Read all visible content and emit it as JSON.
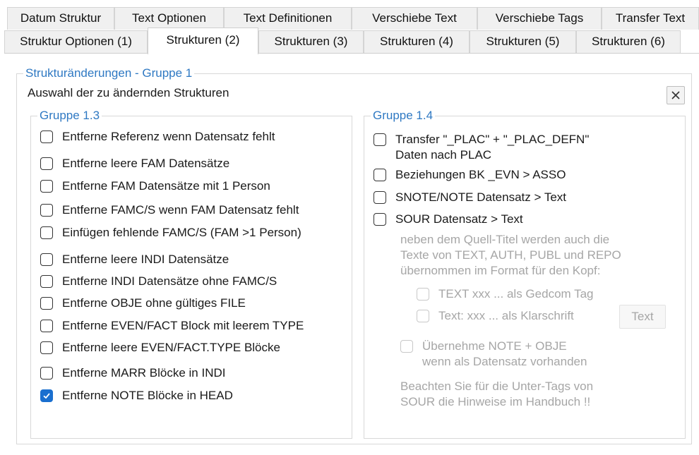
{
  "tabs_row1": [
    {
      "label": "Datum Struktur"
    },
    {
      "label": "Text Optionen"
    },
    {
      "label": "Text Definitionen"
    },
    {
      "label": "Verschiebe Text"
    },
    {
      "label": "Verschiebe Tags"
    },
    {
      "label": "Transfer Text"
    }
  ],
  "tabs_row2": [
    {
      "label": "Struktur Optionen (1)"
    },
    {
      "label": "Strukturen (2)",
      "active": true
    },
    {
      "label": "Strukturen (3)"
    },
    {
      "label": "Strukturen (4)"
    },
    {
      "label": "Strukturen (5)"
    },
    {
      "label": "Strukturen (6)"
    }
  ],
  "main": {
    "group_title": "Strukturänderungen - Gruppe 1",
    "subtitle": "Auswahl der zu ändernden Strukturen",
    "close_icon": "close-icon"
  },
  "group13": {
    "title": "Gruppe 1.3",
    "items": [
      {
        "label": "Entferne Referenz wenn Datensatz fehlt",
        "checked": false
      },
      {
        "label": "Entferne leere FAM Datensätze",
        "checked": false
      },
      {
        "label": "Entferne FAM Datensätze mit 1 Person",
        "checked": false
      },
      {
        "label": "Entferne FAMC/S wenn FAM Datensatz fehlt",
        "checked": false
      },
      {
        "label": "Einfügen fehlende FAMC/S (FAM >1 Person)",
        "checked": false
      },
      {
        "label": "Entferne leere INDI Datensätze",
        "checked": false
      },
      {
        "label": "Entferne INDI Datensätze ohne FAMC/S",
        "checked": false
      },
      {
        "label": "Entferne OBJE ohne gültiges FILE",
        "checked": false
      },
      {
        "label": "Entferne EVEN/FACT Block mit leerem TYPE",
        "checked": false
      },
      {
        "label": "Entferne leere EVEN/FACT.TYPE Blöcke",
        "checked": false
      },
      {
        "label": "Entferne MARR Blöcke in INDI",
        "checked": false
      },
      {
        "label": "Entferne NOTE Blöcke in HEAD",
        "checked": true
      }
    ]
  },
  "group14": {
    "title": "Gruppe 1.4",
    "items": [
      {
        "line1": "Transfer \"_PLAC\" + \"_PLAC_DEFN\"",
        "line2": "Daten nach PLAC",
        "checked": false
      },
      {
        "line1": "Beziehungen BK _EVN > ASSO",
        "checked": false
      },
      {
        "line1": "SNOTE/NOTE Datensatz > Text",
        "checked": false
      },
      {
        "line1": "SOUR Datensatz > Text",
        "checked": false
      }
    ],
    "sour_note": [
      "neben dem Quell-Titel werden auch die",
      "Texte von TEXT, AUTH, PUBL und REPO",
      "übernommen im Format für den Kopf:"
    ],
    "sub_options": [
      {
        "label": "TEXT xxx ... als Gedcom Tag",
        "checked": false
      },
      {
        "label": "Text: xxx ... als Klarschrift",
        "checked": false
      }
    ],
    "text_button": "Text",
    "uebernehme": {
      "line1": "Übernehme NOTE + OBJE",
      "line2": "wenn als Datensatz vorhanden",
      "checked": false
    },
    "hint": [
      "Beachten Sie für die Unter-Tags von",
      "SOUR die Hinweise im Handbuch !!"
    ]
  }
}
